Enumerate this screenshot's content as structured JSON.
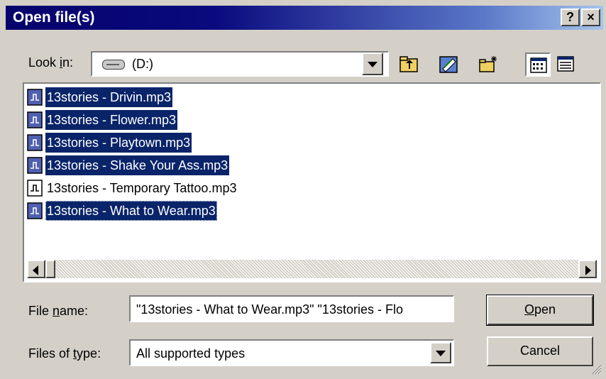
{
  "window": {
    "title": "Open file(s)",
    "help_label": "?",
    "close_label": "×"
  },
  "lookin": {
    "label_pre": "Look ",
    "label_accel": "i",
    "label_post": "n:",
    "value": "(D:)",
    "drive_icon": "hard-drive-icon"
  },
  "toolbar": {
    "up_icon": "up-one-level-icon",
    "desktop_icon": "desktop-icon",
    "new_folder_icon": "new-folder-icon",
    "list_icon": "list-view-icon",
    "details_icon": "details-view-icon"
  },
  "files": [
    {
      "name": "13stories - Drivin.mp3",
      "selected": true
    },
    {
      "name": "13stories - Flower.mp3",
      "selected": true
    },
    {
      "name": "13stories - Playtown.mp3",
      "selected": true
    },
    {
      "name": "13stories - Shake Your Ass.mp3",
      "selected": true
    },
    {
      "name": "13stories - Temporary Tattoo.mp3",
      "selected": false
    },
    {
      "name": "13stories - What to Wear.mp3",
      "selected": true
    }
  ],
  "filename": {
    "label_pre": "File ",
    "label_accel": "n",
    "label_post": "ame:",
    "value": "\"13stories - What to Wear.mp3\" \"13stories - Flo"
  },
  "filetype": {
    "label_pre": "Files of ",
    "label_accel": "t",
    "label_post": "ype:",
    "value": "All supported types"
  },
  "buttons": {
    "open_accel": "O",
    "open_rest": "pen",
    "cancel": "Cancel"
  },
  "colors": {
    "selection": "#0a246a",
    "title_start": "#06026b",
    "title_end": "#a6c4ec",
    "face": "#d4d0c8"
  }
}
